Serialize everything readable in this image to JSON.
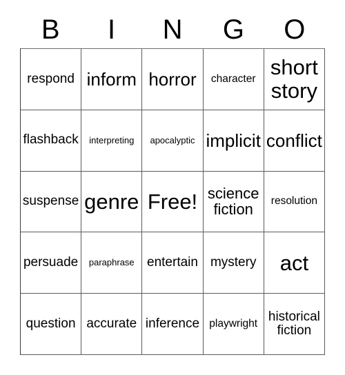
{
  "card": {
    "title": "BINGO",
    "headers": [
      "B",
      "I",
      "N",
      "G",
      "O"
    ],
    "rows": [
      [
        {
          "text": "respond",
          "size": "md"
        },
        {
          "text": "inform",
          "size": "xl"
        },
        {
          "text": "horror",
          "size": "xl"
        },
        {
          "text": "character",
          "size": "sm"
        },
        {
          "text": "short\nstory",
          "size": "xxl"
        }
      ],
      [
        {
          "text": "flashback",
          "size": "md"
        },
        {
          "text": "interpreting",
          "size": "xs"
        },
        {
          "text": "apocalyptic",
          "size": "xs"
        },
        {
          "text": "implicit",
          "size": "xl"
        },
        {
          "text": "conflict",
          "size": "xl"
        }
      ],
      [
        {
          "text": "suspense",
          "size": "md"
        },
        {
          "text": "genre",
          "size": "xxl"
        },
        {
          "text": "Free!",
          "size": "xxl"
        },
        {
          "text": "science\nfiction",
          "size": "lg"
        },
        {
          "text": "resolution",
          "size": "sm"
        }
      ],
      [
        {
          "text": "persuade",
          "size": "md"
        },
        {
          "text": "paraphrase",
          "size": "xs"
        },
        {
          "text": "entertain",
          "size": "md"
        },
        {
          "text": "mystery",
          "size": "md"
        },
        {
          "text": "act",
          "size": "xxl"
        }
      ],
      [
        {
          "text": "question",
          "size": "md"
        },
        {
          "text": "accurate",
          "size": "md"
        },
        {
          "text": "inference",
          "size": "md"
        },
        {
          "text": "playwright",
          "size": "sm"
        },
        {
          "text": "historical\nfiction",
          "size": "md"
        }
      ]
    ],
    "free_space": {
      "row": 2,
      "col": 2,
      "label": "Free!"
    },
    "colors": {
      "background": "#ffffff",
      "text": "#000000",
      "grid_line": "#5a5a5a"
    }
  }
}
